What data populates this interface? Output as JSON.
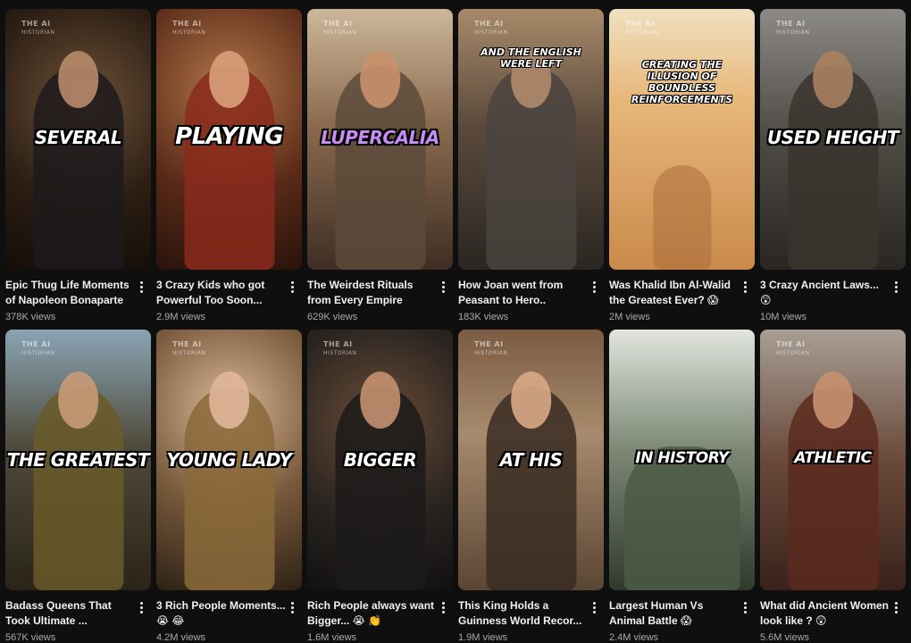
{
  "watermark": {
    "line1": "THE AI",
    "line2": "HISTORIAN"
  },
  "videos": [
    {
      "caption": "SEVERAL",
      "title": "Epic Thug Life Moments of Napoleon Bonaparte",
      "views": "378K views"
    },
    {
      "caption": "PLAYING",
      "title": "3 Crazy Kids who got Powerful Too Soon...",
      "views": "2.9M views"
    },
    {
      "caption": "LUPERCALIA",
      "title": "The Weirdest Rituals from Every Empire",
      "views": "629K views"
    },
    {
      "caption": "AND THE ENGLISH WERE LEFT",
      "title": "How Joan went from Peasant to Hero..",
      "views": "183K views"
    },
    {
      "caption": "CREATING THE ILLUSION OF BOUNDLESS REINFORCEMENTS",
      "title": "Was Khalid Ibn Al-Walid the Greatest Ever? 😱",
      "views": "2M views"
    },
    {
      "caption": "USED HEIGHT",
      "title": "3 Crazy Ancient Laws... 😲",
      "views": "10M views"
    },
    {
      "caption": "THE GREATEST",
      "title": "Badass Queens That Took Ultimate ...",
      "views": "567K views"
    },
    {
      "caption": "YOUNG LADY",
      "title": "3 Rich People Moments... 😭 😂",
      "views": "4.2M views"
    },
    {
      "caption": "BIGGER",
      "title": "Rich People always want Bigger... 😭 👏",
      "views": "1.6M views"
    },
    {
      "caption": "AT HIS",
      "title": "This King Holds a Guinness World Recor...",
      "views": "1.9M views"
    },
    {
      "caption": "IN HISTORY",
      "title": "Largest Human Vs Animal Battle 😱",
      "views": "2.4M views"
    },
    {
      "caption": "ATHLETIC",
      "title": "What did Ancient Women look like ? 😲",
      "views": "5.6M views"
    }
  ],
  "colors": {
    "background": "#0f0f0f",
    "title": "#f1f1f1",
    "views": "#aaaaaa",
    "caption_accent": "#c88cf5"
  }
}
